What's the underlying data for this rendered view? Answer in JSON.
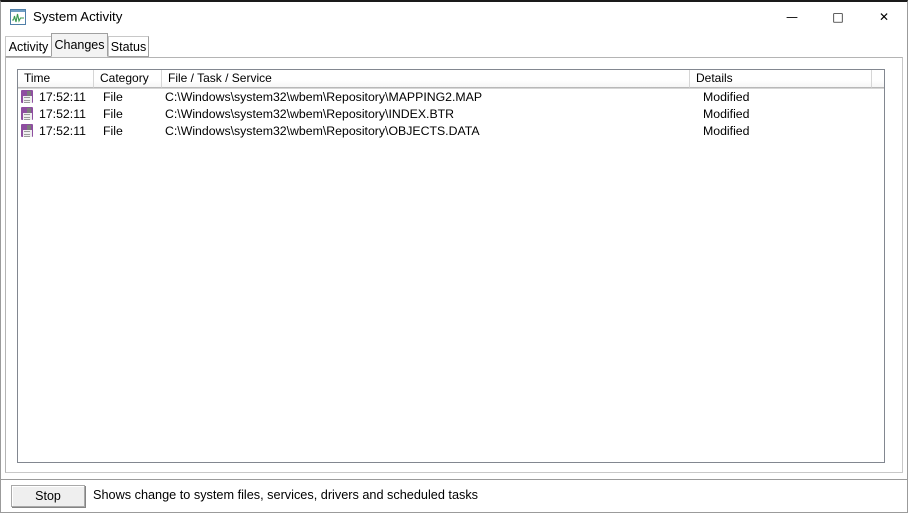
{
  "window": {
    "title": "System Activity",
    "icon": "activity-graph-icon",
    "controls": {
      "minimize": "—",
      "maximize": "□",
      "close": "✕"
    }
  },
  "tabs": [
    {
      "label": "Activity",
      "active": false
    },
    {
      "label": "Changes",
      "active": true
    },
    {
      "label": "Status",
      "active": false
    }
  ],
  "listview": {
    "columns": [
      {
        "label": "Time"
      },
      {
        "label": "Category"
      },
      {
        "label": "File / Task / Service"
      },
      {
        "label": "Details"
      },
      {
        "label": ""
      }
    ],
    "rows": [
      {
        "icon": "floppy-disk-icon",
        "time": "17:52:11",
        "category": "File",
        "file": "C:\\Windows\\system32\\wbem\\Repository\\MAPPING2.MAP",
        "details": "Modified"
      },
      {
        "icon": "floppy-disk-icon",
        "time": "17:52:11",
        "category": "File",
        "file": "C:\\Windows\\system32\\wbem\\Repository\\INDEX.BTR",
        "details": "Modified"
      },
      {
        "icon": "floppy-disk-icon",
        "time": "17:52:11",
        "category": "File",
        "file": "C:\\Windows\\system32\\wbem\\Repository\\OBJECTS.DATA",
        "details": "Modified"
      }
    ]
  },
  "bottom": {
    "stop_label": "Stop",
    "status_text": "Shows change to system files, services, drivers and scheduled tasks"
  },
  "colors": {
    "accent_icon_purple": "#8e4ea0",
    "title_icon_blue": "#4f7fa8",
    "graph_green": "#3a9a4f",
    "window_border": "#9b9b9b",
    "listview_border": "#828790"
  }
}
